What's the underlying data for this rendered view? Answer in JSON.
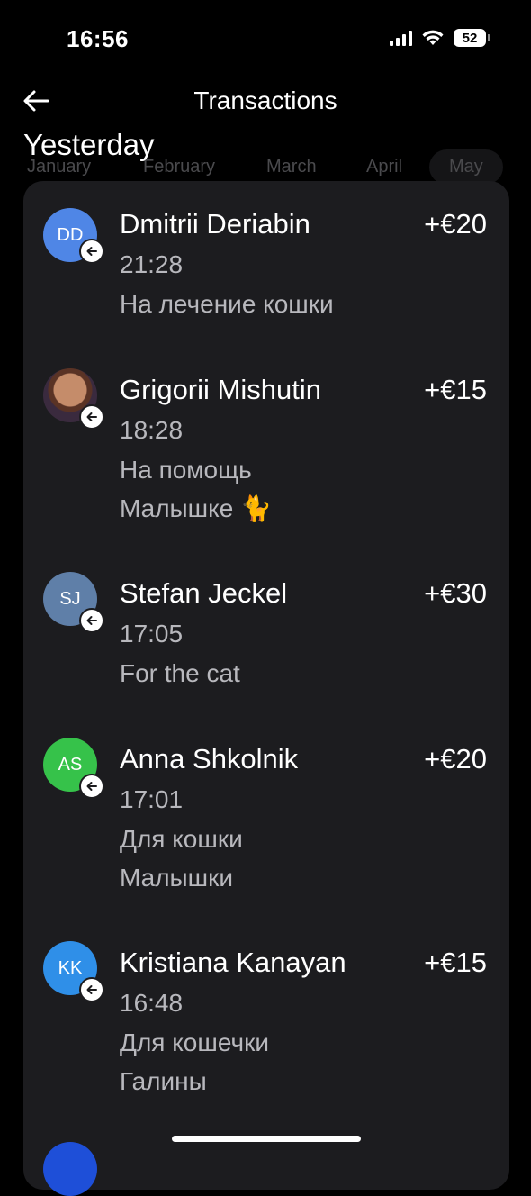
{
  "status": {
    "time": "16:56",
    "battery": "52"
  },
  "header": {
    "title": "Transactions"
  },
  "months": [
    "January",
    "February",
    "March",
    "April",
    "May"
  ],
  "section": {
    "title": "Yesterday"
  },
  "transactions": [
    {
      "initials": "DD",
      "avatar_color": "#4f86e6",
      "name": "Dmitrii Deriabin",
      "amount": "+€20",
      "time": "21:28",
      "note": [
        "На лечение кошки"
      ]
    },
    {
      "initials": "",
      "avatar_color": "#5a3325",
      "name": "Grigorii Mishutin",
      "amount": "+€15",
      "time": "18:28",
      "note": [
        "На помощь",
        "Малышке 🐈"
      ]
    },
    {
      "initials": "SJ",
      "avatar_color": "#5f7fa8",
      "name": "Stefan Jeckel",
      "amount": "+€30",
      "time": "17:05",
      "note": [
        "For the cat"
      ]
    },
    {
      "initials": "AS",
      "avatar_color": "#36c24a",
      "name": "Anna Shkolnik",
      "amount": "+€20",
      "time": "17:01",
      "note": [
        "Для кошки",
        "Малышки"
      ]
    },
    {
      "initials": "KK",
      "avatar_color": "#2f8fe8",
      "name": "Kristiana Kanayan",
      "amount": "+€15",
      "time": "16:48",
      "note": [
        "Для кошечки",
        "Галины"
      ]
    }
  ],
  "colors": {
    "background": "#000000",
    "card": "#1c1c1f",
    "secondary_text": "#b8b8bd",
    "peek_avatar": "#1e4fd8"
  }
}
